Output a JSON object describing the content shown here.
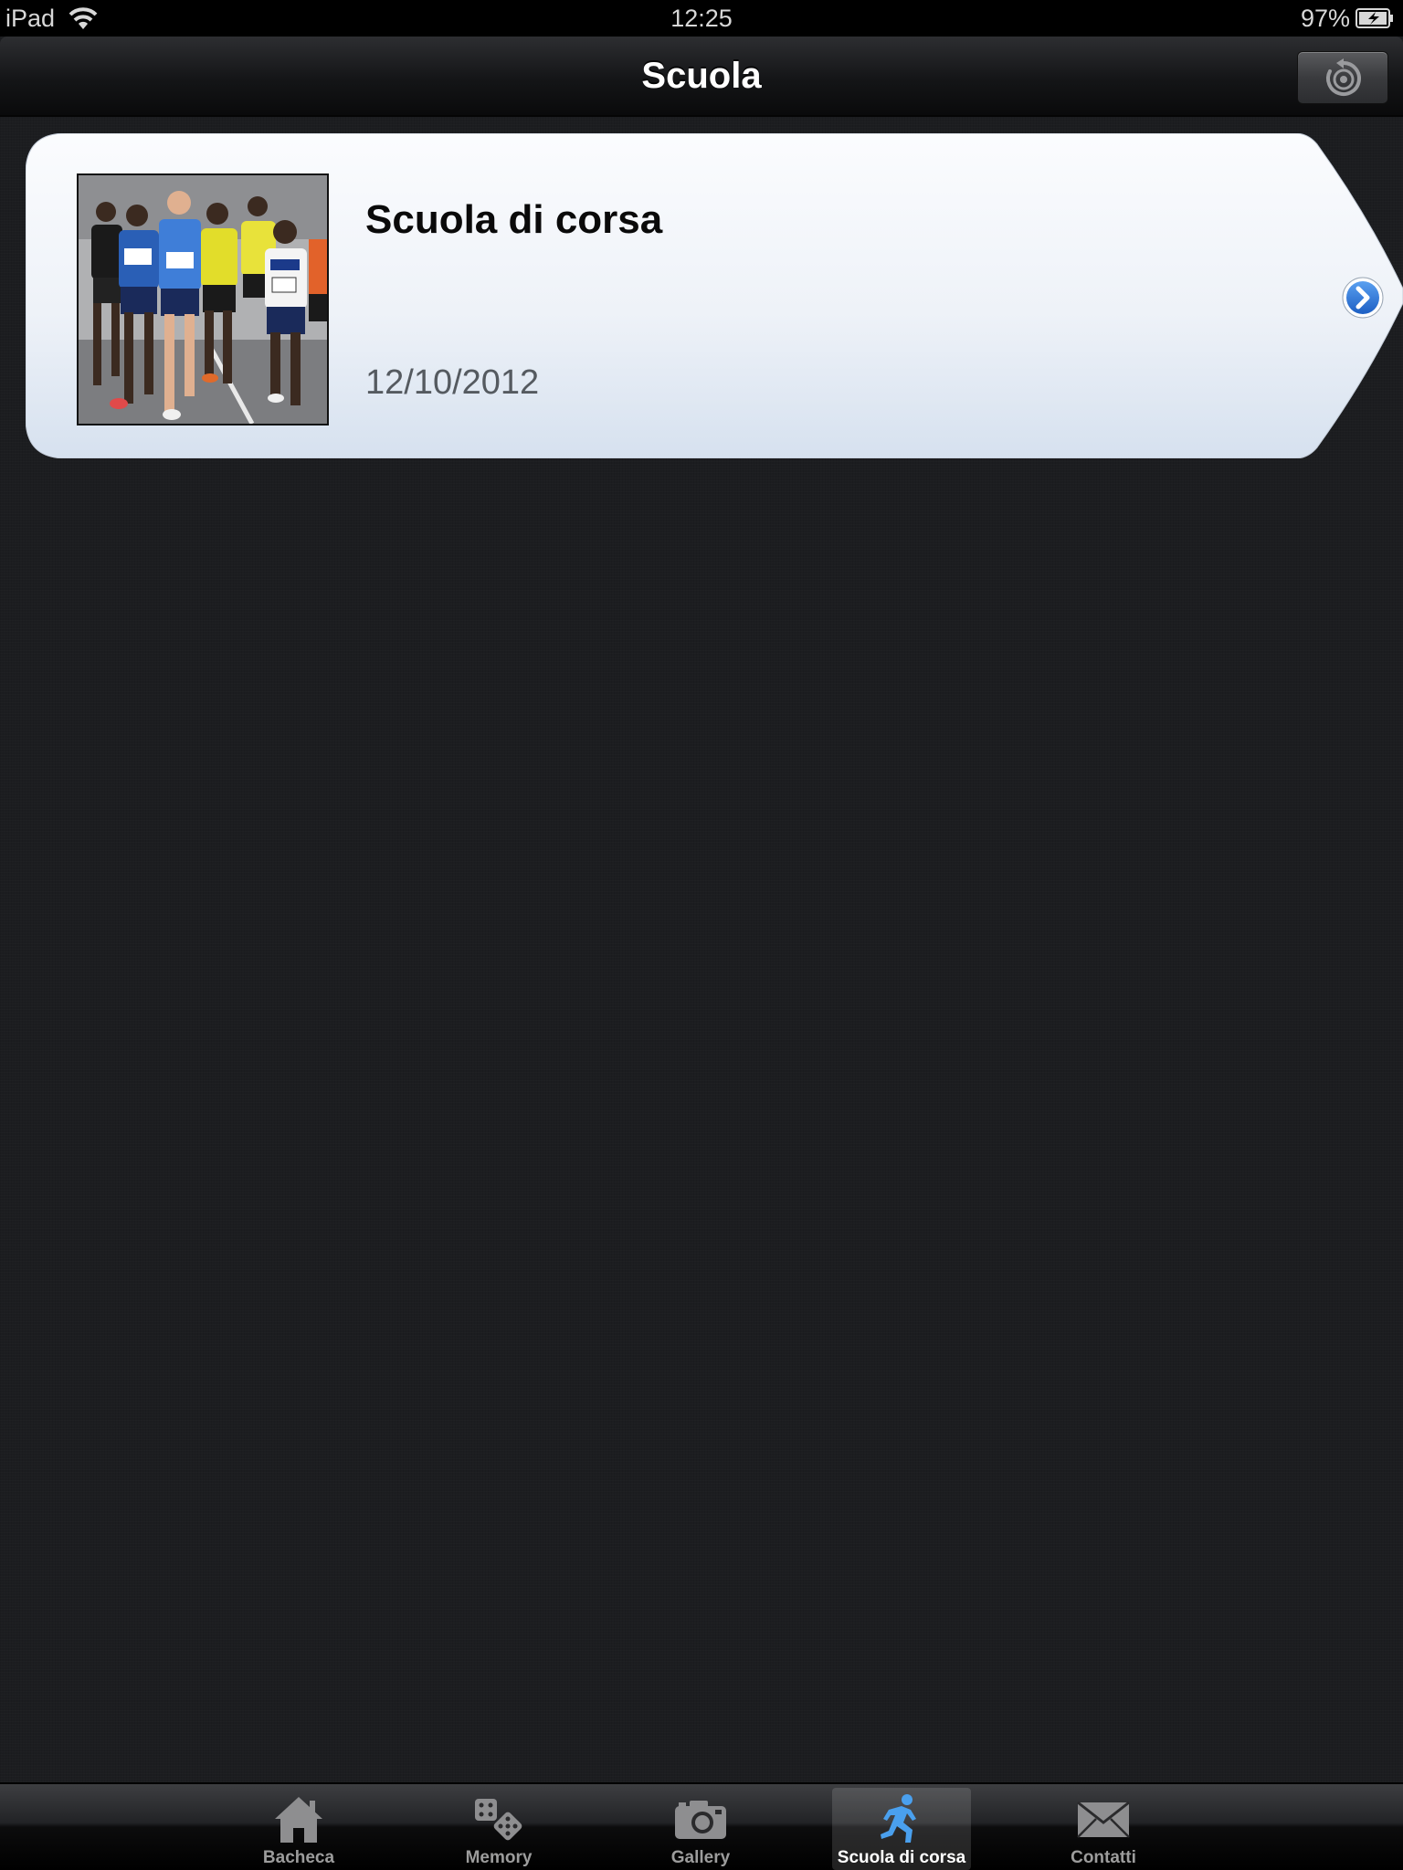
{
  "status_bar": {
    "device": "iPad",
    "time": "12:25",
    "battery": "97%"
  },
  "nav": {
    "title": "Scuola",
    "refresh_icon": "refresh-icon"
  },
  "list": {
    "items": [
      {
        "title": "Scuola di corsa",
        "date": "12/10/2012",
        "thumbnail": "marathon-runners-photo",
        "accessory": "chevron-right-circle-icon"
      }
    ]
  },
  "tab_bar": {
    "selected_index": 3,
    "accent_color": "#3a8ee6",
    "tabs": [
      {
        "label": "Bacheca",
        "icon": "home-icon"
      },
      {
        "label": "Memory",
        "icon": "dice-icon"
      },
      {
        "label": "Gallery",
        "icon": "camera-icon"
      },
      {
        "label": "Scuola di corsa",
        "icon": "runner-icon"
      },
      {
        "label": "Contatti",
        "icon": "envelope-icon"
      }
    ]
  }
}
